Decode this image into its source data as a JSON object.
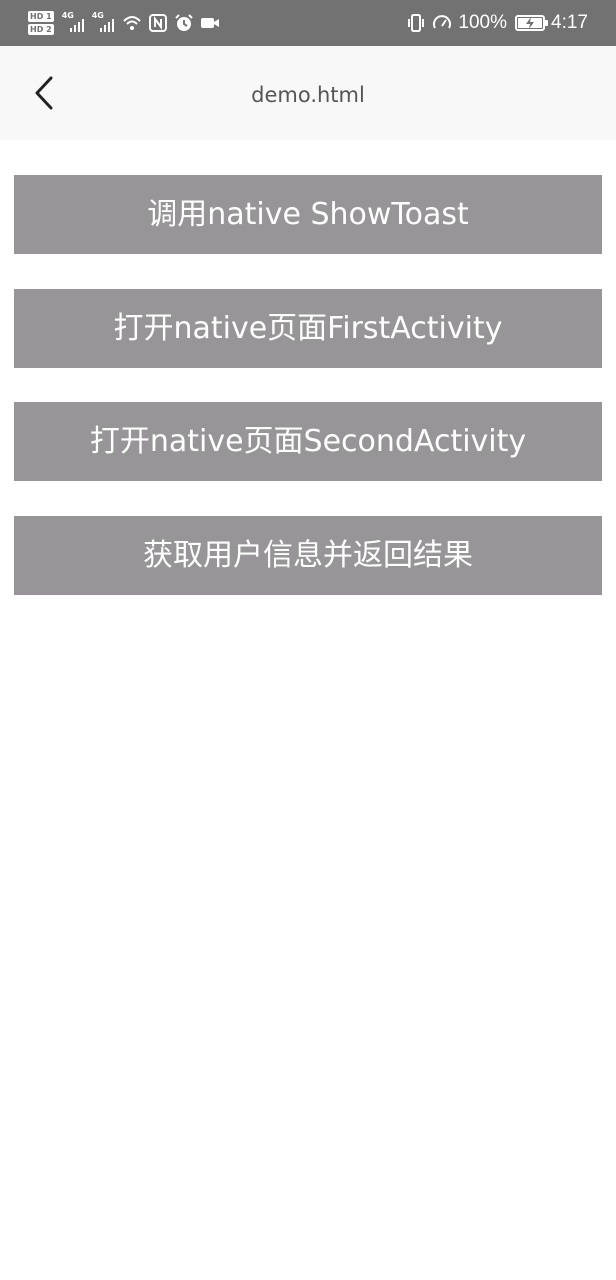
{
  "status_bar": {
    "sim1_label": "HD 1",
    "sim2_label": "HD 2",
    "network1": "4G",
    "network2": "4G",
    "battery_percent": "100%",
    "battery_level": 1.0,
    "time": "4:17",
    "icons": [
      "hd-icon",
      "signal-icon",
      "wifi-icon",
      "nfc-icon",
      "alarm-icon",
      "video-icon",
      "vibrate-icon",
      "speedometer-icon",
      "battery-icon"
    ]
  },
  "header": {
    "title": "demo.html",
    "back_icon": "chevron-left-icon"
  },
  "buttons": [
    {
      "label": "调用native ShowToast"
    },
    {
      "label": "打开native页面FirstActivity"
    },
    {
      "label": "打开native页面SecondActivity"
    },
    {
      "label": "获取用户信息并返回结果"
    }
  ],
  "colors": {
    "status_bar_bg": "#727272",
    "nav_bar_bg": "#f8f8f9",
    "button_bg": "#979597",
    "button_text": "#ffffff",
    "title_text": "#555555"
  }
}
